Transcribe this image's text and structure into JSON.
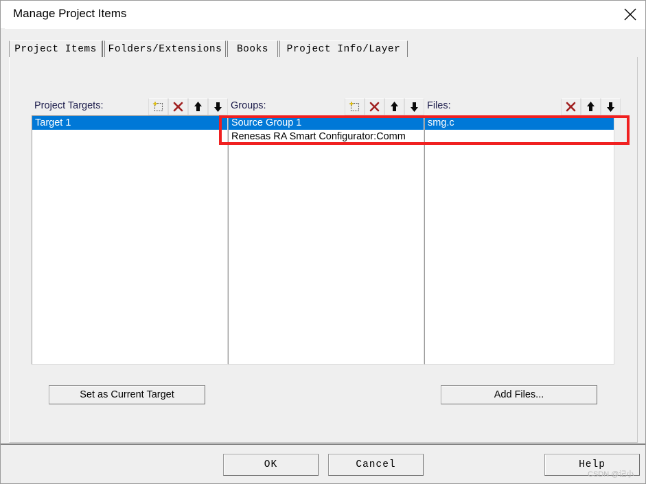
{
  "window": {
    "title": "Manage Project Items",
    "close_icon": "close-icon"
  },
  "tabs": [
    {
      "label": "Project Items",
      "active": true
    },
    {
      "label": "Folders/Extensions",
      "active": false
    },
    {
      "label": "Books",
      "active": false
    },
    {
      "label": "Project Info/Layer",
      "active": false
    }
  ],
  "columns": {
    "targets": {
      "label": "Project Targets:",
      "toolbar": [
        {
          "icon": "new-item-icon",
          "title": "New (Insert)"
        },
        {
          "icon": "delete-x-icon",
          "title": "Remove Item"
        },
        {
          "icon": "move-up-arrow-icon",
          "title": "Move Up"
        },
        {
          "icon": "move-down-arrow-icon",
          "title": "Move Down"
        }
      ],
      "items": [
        {
          "label": "Target 1",
          "selected": true
        }
      ],
      "button": "Set as Current Target"
    },
    "groups": {
      "label": "Groups:",
      "toolbar": [
        {
          "icon": "new-item-icon",
          "title": "New (Insert)"
        },
        {
          "icon": "delete-x-icon",
          "title": "Remove Item"
        },
        {
          "icon": "move-up-arrow-icon",
          "title": "Move Up"
        },
        {
          "icon": "move-down-arrow-icon",
          "title": "Move Down"
        }
      ],
      "items": [
        {
          "label": "Source Group 1",
          "selected": true
        },
        {
          "label": "Renesas RA Smart Configurator:Comm",
          "selected": false
        }
      ]
    },
    "files": {
      "label": "Files:",
      "toolbar": [
        {
          "icon": "delete-x-icon",
          "title": "Remove Item"
        },
        {
          "icon": "move-up-arrow-icon",
          "title": "Move Up"
        },
        {
          "icon": "move-down-arrow-icon",
          "title": "Move Down"
        }
      ],
      "items": [
        {
          "label": "smg.c",
          "selected": true
        }
      ],
      "button": "Add Files..."
    }
  },
  "footer": {
    "ok": "OK",
    "cancel": "Cancel",
    "help": "Help"
  },
  "annotation": {
    "color": "#f02020",
    "shape": "rectangle-highlight"
  },
  "watermark": "CSDN @记小",
  "colors": {
    "selection_blue": "#0078d7",
    "dialog_face": "#efefef",
    "label_navy": "#1a1a4a",
    "delete_red": "#a02020",
    "annotation_red": "#f02020"
  }
}
